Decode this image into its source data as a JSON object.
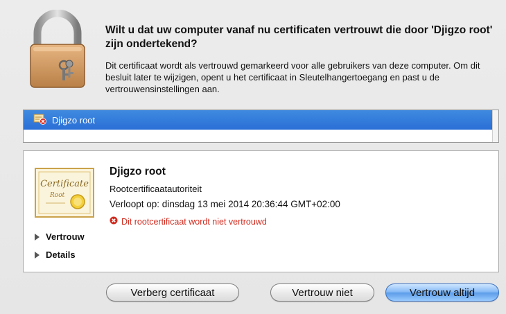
{
  "dialog": {
    "headline": "Wilt u dat uw computer vanaf nu certificaten vertrouwt die door 'Djigzo root' zijn ondertekend?",
    "description": "Dit certificaat wordt als vertrouwd gemarkeerd voor alle gebruikers van deze computer. Om dit besluit later te wijzigen, opent u het certificaat in Sleutelhangertoegang en past u de vertrouwensinstellingen aan."
  },
  "cert_list": {
    "items": [
      {
        "label": "Djigzo root",
        "icon": "certificate-untrusted-icon",
        "selected": true
      }
    ]
  },
  "certificate": {
    "name": "Djigzo root",
    "kind": "Rootcertificaatautoriteit",
    "expiry": "Verloopt op: dinsdag 13 mei 2014 20:36:44 GMT+02:00",
    "warning": "Dit rootcertificaat wordt niet vertrouwd",
    "image_script": "Certificate",
    "image_subtext": "Root",
    "sections": [
      {
        "label": "Vertrouw"
      },
      {
        "label": "Details"
      }
    ]
  },
  "buttons": {
    "hide_cert": "Verberg certificaat",
    "dont_trust": "Vertrouw niet",
    "always_trust": "Vertrouw altijd"
  },
  "colors": {
    "selection": "#2f78db",
    "warning": "#d12b1f",
    "default_button": "#5a9be8"
  }
}
